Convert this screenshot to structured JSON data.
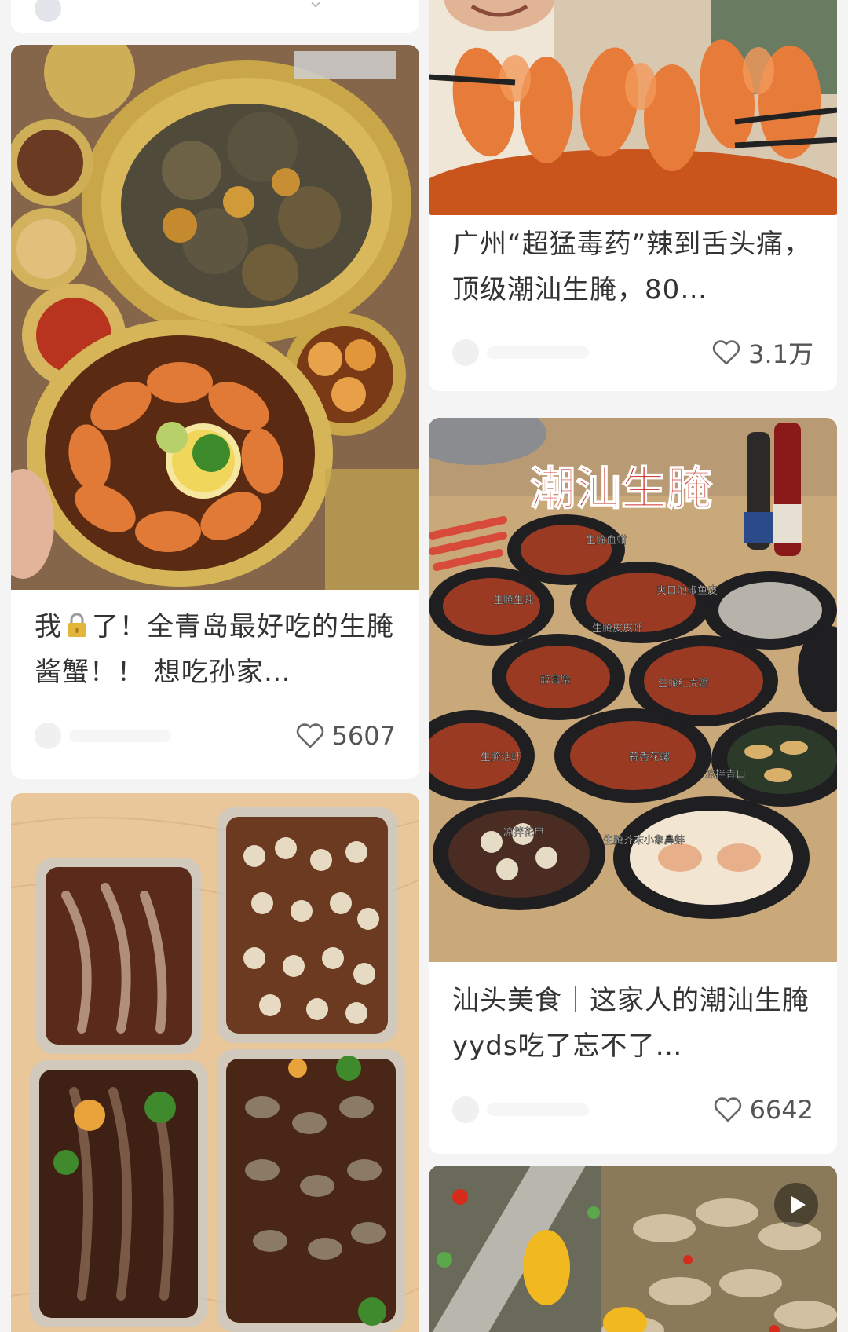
{
  "feed": {
    "left": [
      {
        "title_part1": "我",
        "lock_icon": "lock-icon",
        "title_part2": "了！全青岛最好吃的生腌酱蟹！！ 想吃孙家…",
        "likes": "5607"
      }
    ],
    "right": [
      {
        "title": "广州“超猛毒药”辣到舌头痛，顶级潮汕生腌，80…",
        "likes": "3.1万"
      },
      {
        "title": "汕头美食｜这家人的潮汕生腌yyds吃了忘不了…",
        "likes": "6642",
        "image_text": {
          "headline": "潮汕生腌",
          "dishes": [
            "生腌血蚶",
            "生腌生蚝",
            "爽口泡椒鱼皮",
            "生腌皮皮虾",
            "醉膏蟹",
            "生腌红壳蟹",
            "生腌活虾",
            "蒜香花螺",
            "凉拌青口",
            "凉拌花甲",
            "生腌芥末小象鼻蚌"
          ]
        }
      }
    ]
  },
  "icons": {
    "heart": "heart-icon",
    "play": "play-icon"
  },
  "colors": {
    "background": "#f4f4f4",
    "card": "#ffffff",
    "title_red": "#c8261e"
  }
}
